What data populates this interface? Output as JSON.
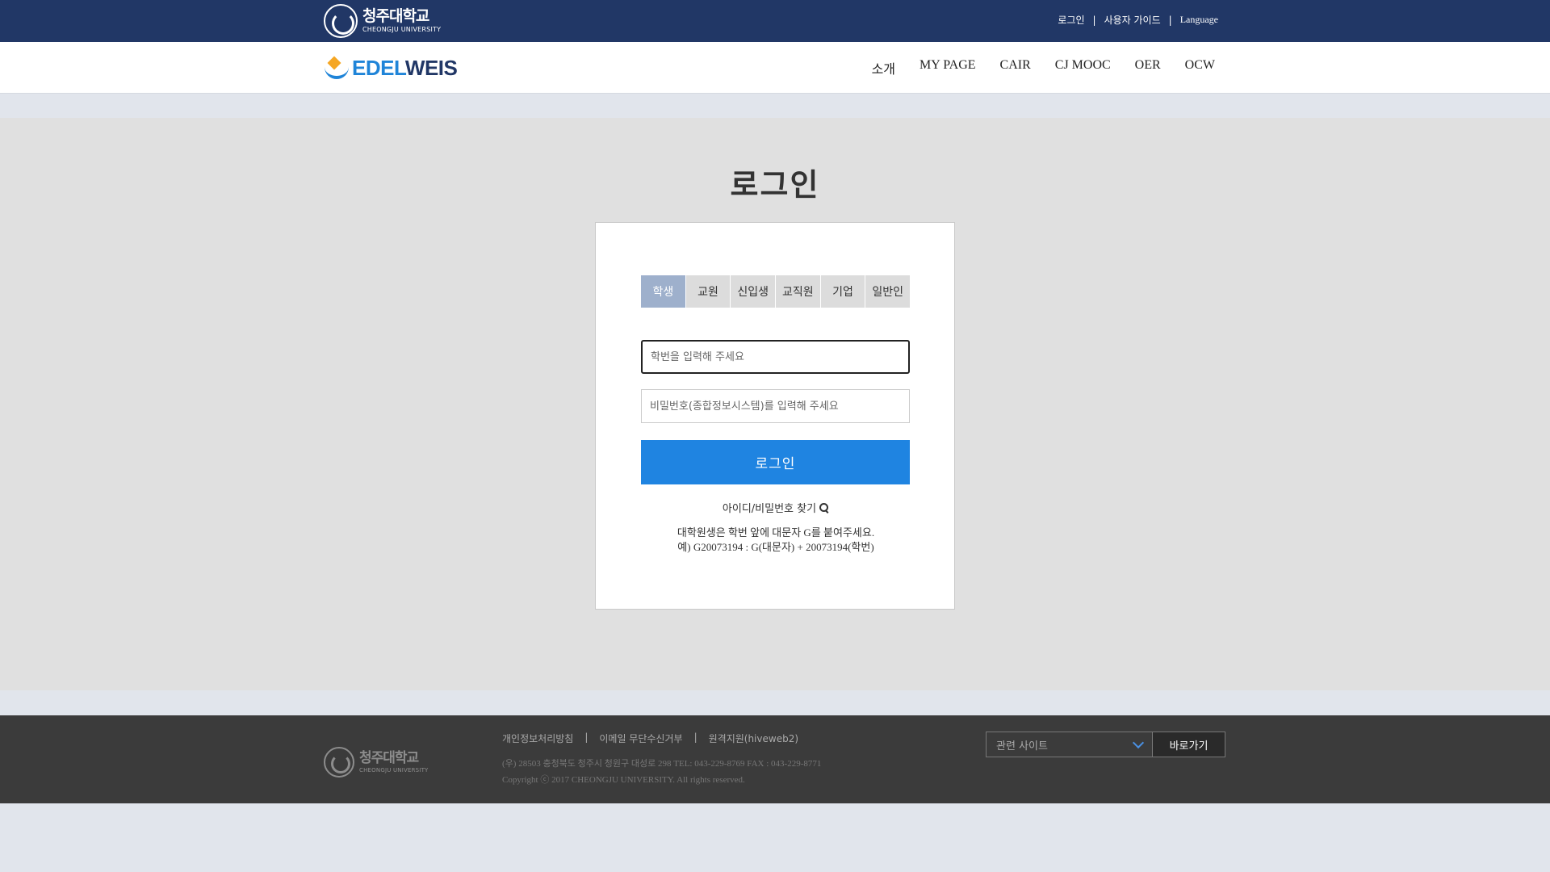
{
  "topbar": {
    "logo_ko": "청주대학교",
    "logo_en": "CHEONGJU UNIVERSITY",
    "links": [
      "로그인",
      "사용자 가이드",
      "Language"
    ],
    "separator": "|"
  },
  "navbar": {
    "logo_part1": "EDEL",
    "logo_part2": "WEIS",
    "menu": [
      "소개",
      "MY PAGE",
      "CAIR",
      "CJ MOOC",
      "OER",
      "OCW"
    ]
  },
  "login": {
    "title": "로그인",
    "tabs": [
      {
        "label": "학생",
        "active": true
      },
      {
        "label": "교원",
        "active": false
      },
      {
        "label": "신입생",
        "active": false
      },
      {
        "label": "교직원",
        "active": false
      },
      {
        "label": "기업",
        "active": false
      },
      {
        "label": "일반인",
        "active": false
      }
    ],
    "id_placeholder": "학번을 입력해 주세요",
    "pw_placeholder": "비밀번호(종합정보시스템)를 입력해 주세요",
    "button": "로그인",
    "find_link": "아이디/비밀번호 찾기",
    "notice_line1": "대학원생은 학번 앞에 대문자 G를 붙여주세요.",
    "notice_line2": "예) G20073194 : G(대문자) + 20073194(학번)"
  },
  "footer": {
    "logo_ko": "청주대학교",
    "logo_en": "CHEONGJU UNIVERSITY",
    "links": [
      "개인정보처리방침",
      "이메일 무단수신거부",
      "원격지원(hiveweb2)"
    ],
    "separator": "|",
    "address": "(우) 28503 충청북도 청주시 청원구 대성로 298 TEL: 043-229-8769 FAX : 043-229-8771",
    "copyright": "Copyright ⓒ 2017 CHEONGJU UNIVERSITY. All rights reserved.",
    "related_select": "관련 사이트",
    "go_button": "바로가기"
  },
  "colors": {
    "topbar": "#213766",
    "accent": "#1f84e1",
    "active_tab": "#9eb0cc",
    "footer": "#3b3b3b"
  }
}
